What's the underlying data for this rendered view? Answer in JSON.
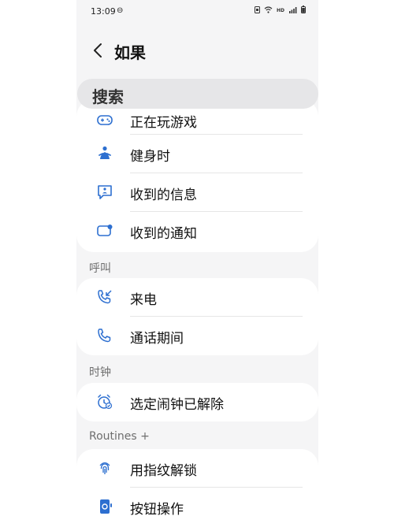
{
  "status_bar": {
    "time": "13:09",
    "dnd_icon": "dnd-icon",
    "icons": [
      "sim-icon",
      "wifi-icon",
      "hd-label",
      "signal-icon",
      "battery-icon"
    ],
    "hd": "HD"
  },
  "header": {
    "back_icon": "chevron-left-icon",
    "title": "如果"
  },
  "search": {
    "label": "搜索"
  },
  "colors": {
    "accent": "#2d6fd0",
    "background": "#f5f5f6",
    "card": "#ffffff",
    "section_text": "#6e6e6e"
  },
  "sections": [
    {
      "title": "",
      "items": [
        {
          "label": "正在玩游戏",
          "icon": "gamepad-icon"
        },
        {
          "label": "健身时",
          "icon": "exercise-icon"
        },
        {
          "label": "收到的信息",
          "icon": "message-icon"
        },
        {
          "label": "收到的通知",
          "icon": "notification-icon"
        }
      ]
    },
    {
      "title": "呼叫",
      "items": [
        {
          "label": "来电",
          "icon": "incoming-call-icon"
        },
        {
          "label": "通话期间",
          "icon": "phone-icon"
        }
      ]
    },
    {
      "title": "时钟",
      "items": [
        {
          "label": "选定闹钟已解除",
          "icon": "alarm-icon"
        }
      ]
    },
    {
      "title": "Routines +",
      "items": [
        {
          "label": "用指纹解锁",
          "icon": "fingerprint-icon"
        },
        {
          "label": "按钮操作",
          "icon": "button-action-icon"
        }
      ]
    }
  ]
}
